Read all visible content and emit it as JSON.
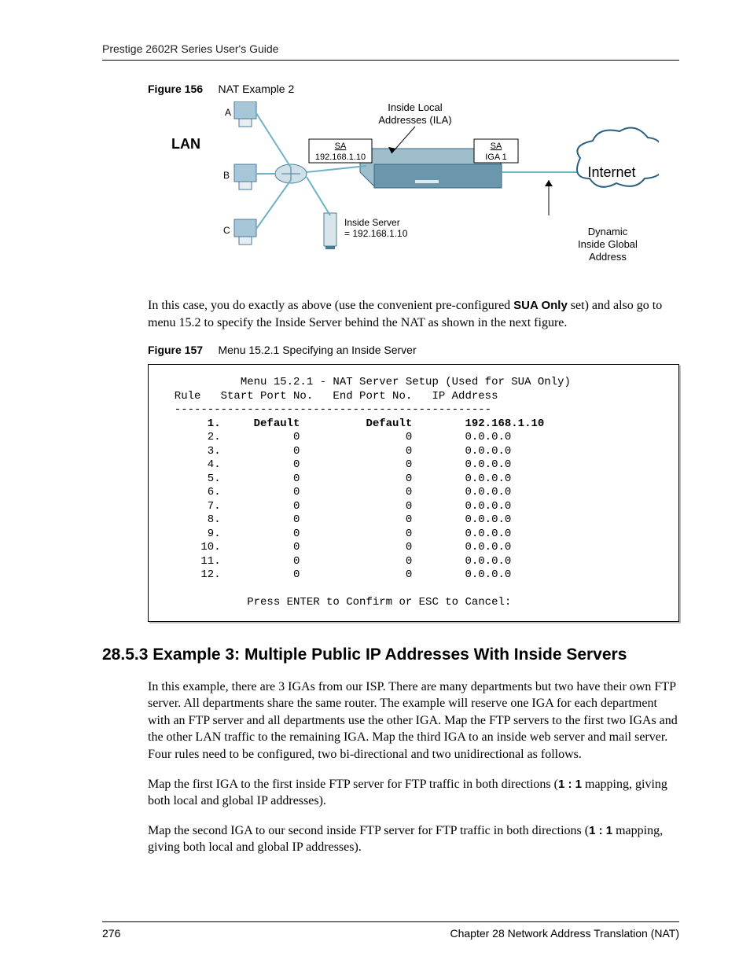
{
  "header_left": "Prestige 2602R Series User's Guide",
  "fig156": {
    "label": "Figure 156",
    "title": "NAT Example 2"
  },
  "diagram": {
    "lan": "LAN",
    "hosts": {
      "a": "A",
      "b": "B",
      "c": "C"
    },
    "sa1": "SA",
    "sa1_ip": "192.168.1.10",
    "sa2": "SA",
    "sa2_ip": "IGA 1",
    "ila_top": "Inside Local",
    "ila_bot": "Addresses (ILA)",
    "server_label": "Inside Server",
    "server_ip": "= 192.168.1.10",
    "internet": "Internet",
    "iga_line1": "Dynamic",
    "iga_line2": "Inside Global",
    "iga_line3": "Address"
  },
  "para1_a": "In this case, you do exactly as above (use the convenient pre-configured ",
  "para1_bold": "SUA Only",
  "para1_b": " set) and also go to menu 15.2 to specify the Inside Server behind the NAT as shown in the next figure.",
  "fig157": {
    "label": "Figure 157",
    "title": "Menu 15.2.1 Specifying an Inside Server"
  },
  "terminal": {
    "title": "Menu 15.2.1 - NAT Server Setup (Used for SUA Only)",
    "cols": "  Rule   Start Port No.   End Port No.   IP Address",
    "sep": "  ------------------------------------------------",
    "rows": [
      {
        "n": " 1.",
        "s": "Default",
        "e": "Default",
        "ip": "192.168.1.10",
        "bold": true
      },
      {
        "n": " 2.",
        "s": "0",
        "e": "0",
        "ip": "0.0.0.0"
      },
      {
        "n": " 3.",
        "s": "0",
        "e": "0",
        "ip": "0.0.0.0"
      },
      {
        "n": " 4.",
        "s": "0",
        "e": "0",
        "ip": "0.0.0.0"
      },
      {
        "n": " 5.",
        "s": "0",
        "e": "0",
        "ip": "0.0.0.0"
      },
      {
        "n": " 6.",
        "s": "0",
        "e": "0",
        "ip": "0.0.0.0"
      },
      {
        "n": " 7.",
        "s": "0",
        "e": "0",
        "ip": "0.0.0.0"
      },
      {
        "n": " 8.",
        "s": "0",
        "e": "0",
        "ip": "0.0.0.0"
      },
      {
        "n": " 9.",
        "s": "0",
        "e": "0",
        "ip": "0.0.0.0"
      },
      {
        "n": "10.",
        "s": "0",
        "e": "0",
        "ip": "0.0.0.0"
      },
      {
        "n": "11.",
        "s": "0",
        "e": "0",
        "ip": "0.0.0.0"
      },
      {
        "n": "12.",
        "s": "0",
        "e": "0",
        "ip": "0.0.0.0"
      }
    ],
    "footer": "Press ENTER to Confirm or ESC to Cancel:"
  },
  "section_heading": "28.5.3  Example 3: Multiple Public IP Addresses With Inside Servers",
  "para2": "In this example, there are 3 IGAs from our ISP. There are many departments but two have their own FTP server. All departments share the same router. The example will reserve one IGA for each department with an FTP server and all departments use the other IGA. Map the FTP servers to the first two IGAs and the other LAN traffic to the remaining IGA. Map the third IGA to an inside web server and mail server. Four rules need to be configured, two bi-directional and two unidirectional as follows.",
  "para3_a": "Map the first IGA to the first inside FTP server for FTP traffic in both directions (",
  "para3_bold": "1 : 1",
  "para3_b": " mapping, giving both local and global IP addresses).",
  "para4_a": "Map the second IGA to our second inside FTP server for FTP traffic in both directions (",
  "para4_bold": "1 : 1",
  "para4_b": " mapping, giving both local and global IP addresses).",
  "footer_left": "276",
  "footer_right": "Chapter 28 Network Address Translation (NAT)"
}
